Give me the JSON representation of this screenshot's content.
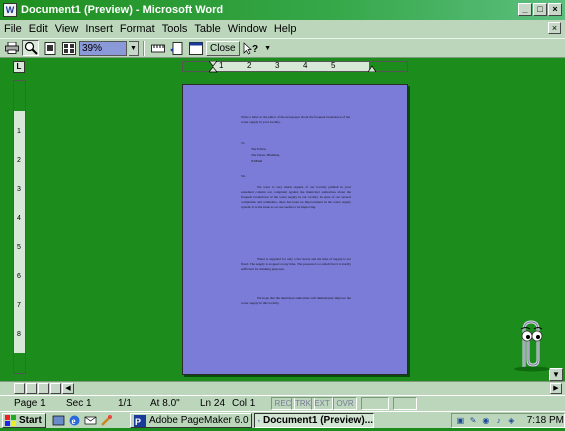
{
  "window": {
    "title": "Document1 (Preview) - Microsoft Word",
    "app_icon": "W"
  },
  "menu": [
    "File",
    "Edit",
    "View",
    "Insert",
    "Format",
    "Tools",
    "Table",
    "Window",
    "Help"
  ],
  "toolbar": {
    "zoom": "39%",
    "close_label": "Close",
    "help_cursor": "?"
  },
  "ruler": {
    "corner": "L",
    "h_numbers": [
      "1",
      "2",
      "3",
      "4",
      "5"
    ],
    "v_numbers": [
      "1",
      "2",
      "3",
      "4",
      "5",
      "6",
      "7",
      "8"
    ]
  },
  "document": {
    "heading": "Write a letter to the editor of the newspaper about the frequent breakdown of the water supply in your locality.",
    "to": "To",
    "address": [
      "The Editor,",
      "The Dawn, Bhubhan,",
      "XXPAR"
    ],
    "salutation": "Sir,",
    "para1": "We want to very much request of our locality publish in your esteemed column our complaint against the municipal authorities about the frequent breakdown of the water supply in our locality. In spite of our several complaints and reminders, there has been no improvement in the water supply system. It is the issue as on one seems to be improving.",
    "para2": "Water is supplied for only a few hours and the time of supply is not fixed. The supply is stopped at any time. The pressure is so small that it is hardly sufficient for drinking purposes.",
    "para3": "We hope that the municipal authorities will immediately improve the water supply in this locality."
  },
  "status": {
    "page": "Page 1",
    "sec": "Sec 1",
    "pages": "1/1",
    "at": "At 8.0\"",
    "ln": "Ln 24",
    "col": "Col 1",
    "modes": [
      "REC",
      "TRK",
      "EXT",
      "OVR"
    ]
  },
  "taskbar": {
    "start": "Start",
    "tasks": [
      "Adobe PageMaker 6.0",
      "Document1 (Preview)..."
    ],
    "clock": "7:18 PM"
  },
  "colors": {
    "desktop": "#1c8c1c",
    "page": "#7b7bd8",
    "chrome": "#bcd6bc"
  }
}
